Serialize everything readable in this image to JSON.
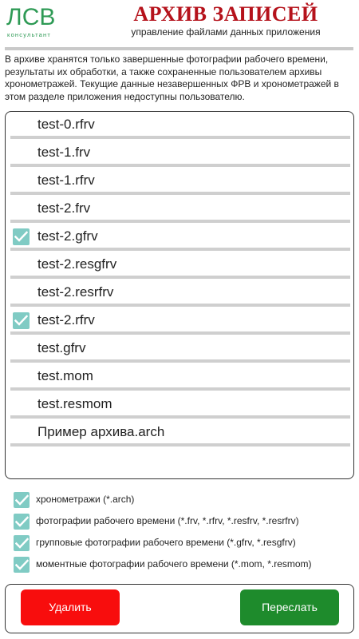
{
  "header": {
    "logo_mark": "ЛСВ",
    "logo_sub": "консультант",
    "title": "АРХИВ ЗАПИСЕЙ",
    "subtitle": "управление файлами данных приложения"
  },
  "info_text": "В архиве хранятся только завершенные фотографии рабочего времени, результаты их обработки, а также сохраненные пользователем архивы хронометражей. Текущие данные незавершенных ФРВ и хронометражей в этом разделе приложения недоступны пользователю.",
  "files": [
    {
      "name": "test-0.rfrv",
      "checked": false
    },
    {
      "name": "test-1.frv",
      "checked": false
    },
    {
      "name": "test-1.rfrv",
      "checked": false
    },
    {
      "name": "test-2.frv",
      "checked": false
    },
    {
      "name": "test-2.gfrv",
      "checked": true
    },
    {
      "name": "test-2.resgfrv",
      "checked": false
    },
    {
      "name": "test-2.resrfrv",
      "checked": false
    },
    {
      "name": "test-2.rfrv",
      "checked": true
    },
    {
      "name": "test.gfrv",
      "checked": false
    },
    {
      "name": "test.mom",
      "checked": false
    },
    {
      "name": "test.resmom",
      "checked": false
    },
    {
      "name": "Пример архива.arch",
      "checked": false
    }
  ],
  "filters": [
    {
      "label": "хронометражи (*.arch)",
      "checked": true
    },
    {
      "label": "фотографии рабочего времени (*.frv, *.rfrv, *.resfrv, *.resrfrv)",
      "checked": true
    },
    {
      "label": "групповые фотографии рабочего времени (*.gfrv, *.resgfrv)",
      "checked": true
    },
    {
      "label": "моментные фотографии рабочего времени (*.mom, *.resmom)",
      "checked": true
    }
  ],
  "actions": {
    "delete_label": "Удалить",
    "send_label": "Переслать"
  },
  "colors": {
    "accent_green": "#2e9a55",
    "title_red": "#b5121b",
    "checkbox_teal": "#80cbc4",
    "delete_red": "#f80d0d",
    "send_green": "#1e8b2c"
  }
}
